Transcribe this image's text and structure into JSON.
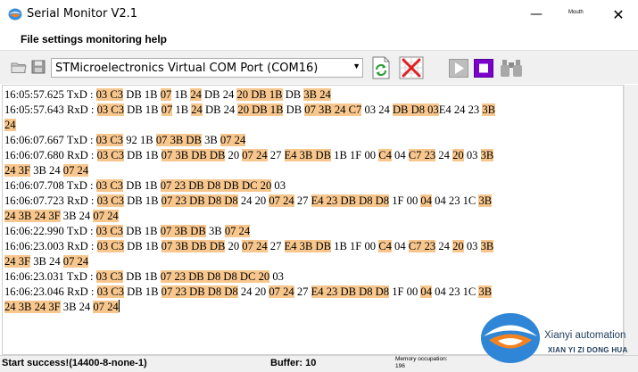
{
  "window": {
    "title": "Serial Monitor V2.1",
    "corner_label": "Mouth",
    "minimize_glyph": "—",
    "maximize_glyph": "☐",
    "close_glyph": "✕"
  },
  "menu": {
    "label": "File settings monitoring help"
  },
  "toolbar": {
    "port": "STMicroelectronics Virtual COM Port (COM16)",
    "icons": [
      "folder-icon",
      "save-icon",
      "refresh-icon",
      "clear-icon",
      "play-icon",
      "stop-icon",
      "binoculars-icon"
    ]
  },
  "log": [
    [
      [
        "16:05:57.625 TxD : ",
        0
      ],
      [
        "03 C3",
        1
      ],
      [
        " DB 1B ",
        0
      ],
      [
        "07",
        1
      ],
      [
        " 1B ",
        0
      ],
      [
        "24",
        1
      ],
      [
        " DB 24 ",
        0
      ],
      [
        "20 DB 1B",
        1
      ],
      [
        " DB ",
        0
      ],
      [
        "3B 24",
        1
      ]
    ],
    [
      [
        "16:05:57.643 RxD : ",
        0
      ],
      [
        "03 C3",
        1
      ],
      [
        " DB 1B ",
        0
      ],
      [
        "07",
        1
      ],
      [
        " 1B ",
        0
      ],
      [
        "24",
        1
      ],
      [
        " DB 24 ",
        0
      ],
      [
        "20 DB 1B",
        1
      ],
      [
        " DB ",
        0
      ],
      [
        "07 3B 24 C7",
        1
      ],
      [
        " 03 24 ",
        0
      ],
      [
        "DB D8 03",
        1
      ],
      [
        "E4 24 23 ",
        0
      ],
      [
        "3B",
        1
      ]
    ],
    [
      [
        "24",
        1
      ]
    ],
    [
      [
        "16:06:07.667 TxD : ",
        0
      ],
      [
        "03 C3",
        1
      ],
      [
        " 92 1B ",
        0
      ],
      [
        "07 3B DB",
        1
      ],
      [
        " 3B ",
        0
      ],
      [
        "07 24",
        1
      ]
    ],
    [
      [
        "16:06:07.680 RxD : ",
        0
      ],
      [
        "03 C3",
        1
      ],
      [
        " DB 1B ",
        0
      ],
      [
        "07 3B DB DB",
        1
      ],
      [
        " 20 ",
        0
      ],
      [
        "07 24",
        1
      ],
      [
        " 27 ",
        0
      ],
      [
        "E4 3B DB",
        1
      ],
      [
        " 1B 1F 00 ",
        0
      ],
      [
        "C4",
        1
      ],
      [
        " 04 ",
        0
      ],
      [
        "C7 23",
        1
      ],
      [
        " 24 ",
        0
      ],
      [
        "20",
        1
      ],
      [
        " 03 ",
        0
      ],
      [
        "3B",
        1
      ]
    ],
    [
      [
        "24 3F",
        1
      ],
      [
        " 3B 24 ",
        0
      ],
      [
        "07 24",
        1
      ]
    ],
    [
      [
        "16:06:07.708 TxD : ",
        0
      ],
      [
        "03 C3",
        1
      ],
      [
        " DB 1B ",
        0
      ],
      [
        "07 23 DB D8 DB DC 20",
        1
      ],
      [
        " 03",
        0
      ]
    ],
    [
      [
        "16:06:07.723 RxD : ",
        0
      ],
      [
        "03 C3",
        1
      ],
      [
        " DB 1B ",
        0
      ],
      [
        "07 23 DB D8 D8",
        1
      ],
      [
        " 24 20 ",
        0
      ],
      [
        "07 24",
        1
      ],
      [
        " 27 ",
        0
      ],
      [
        "E4 23 DB D8 D8",
        1
      ],
      [
        " 1F 00 ",
        0
      ],
      [
        "04",
        1
      ],
      [
        " 04 23 1C ",
        0
      ],
      [
        "3B",
        1
      ]
    ],
    [
      [
        "24 3B 24 3F",
        1
      ],
      [
        " 3B 24 ",
        0
      ],
      [
        "07 24",
        1
      ]
    ],
    [
      [
        "16:06:22.990 TxD : ",
        0
      ],
      [
        "03 C3",
        1
      ],
      [
        " DB 1B ",
        0
      ],
      [
        "07 3B DB",
        1
      ],
      [
        " 3B ",
        0
      ],
      [
        "07 24",
        1
      ]
    ],
    [
      [
        "16:06:23.003 RxD : ",
        0
      ],
      [
        "03 C3",
        1
      ],
      [
        " DB 1B ",
        0
      ],
      [
        "07 3B DB DB",
        1
      ],
      [
        " 20 ",
        0
      ],
      [
        "07 24",
        1
      ],
      [
        " 27 ",
        0
      ],
      [
        "E4 3B DB",
        1
      ],
      [
        " 1B 1F 00 ",
        0
      ],
      [
        "C4",
        1
      ],
      [
        " 04 ",
        0
      ],
      [
        "C7 23",
        1
      ],
      [
        " 24 ",
        0
      ],
      [
        "20",
        1
      ],
      [
        " 03 ",
        0
      ],
      [
        "3B",
        1
      ]
    ],
    [
      [
        "24 3F",
        1
      ],
      [
        " 3B 24 ",
        0
      ],
      [
        "07 24",
        1
      ]
    ],
    [
      [
        "16:06:23.031 TxD : ",
        0
      ],
      [
        "03 C3",
        1
      ],
      [
        " DB 1B ",
        0
      ],
      [
        "07 23 DB D8 D8 DC 20",
        1
      ],
      [
        " 03",
        0
      ]
    ],
    [
      [
        "16:06:23.046 RxD : ",
        0
      ],
      [
        "03 C3",
        1
      ],
      [
        " DB 1B ",
        0
      ],
      [
        "07 23 DB D8 D8",
        1
      ],
      [
        " 24 20 ",
        0
      ],
      [
        "07 24",
        1
      ],
      [
        " 27 ",
        0
      ],
      [
        "E4 23 DB D8 D8",
        1
      ],
      [
        " 1F 00 ",
        0
      ],
      [
        "04",
        1
      ],
      [
        " 04 23 1C ",
        0
      ],
      [
        "3B",
        1
      ]
    ],
    [
      [
        "24 3B 24 3F",
        1
      ],
      [
        " 3B 24 ",
        0
      ],
      [
        "07 24",
        1
      ]
    ]
  ],
  "status": {
    "message": "Start success!(14400-8-none-1)",
    "buffer": "Buffer: 10",
    "memory_label": "Memory occupation:",
    "memory_value": "196"
  },
  "watermark": {
    "name": "Xianyi automation",
    "subtitle": "XIAN YI ZI DONG HUA"
  },
  "colors": {
    "highlight": "#f8c78e",
    "toolbar_bg": "#f0f0f0",
    "stop_purple": "#7a00cc",
    "clear_red": "#e02020",
    "refresh_green": "#2e9e3a"
  }
}
